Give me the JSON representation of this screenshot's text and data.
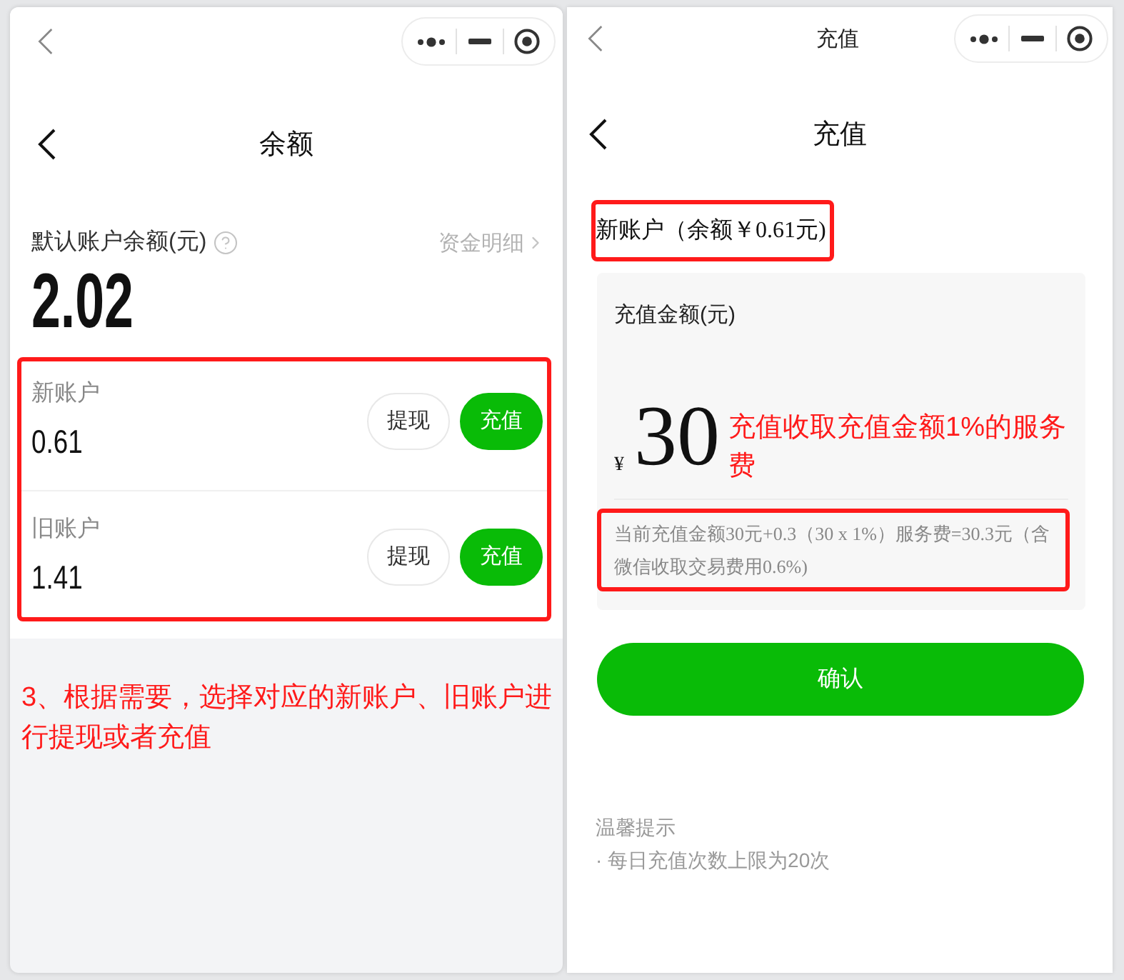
{
  "balance_screen": {
    "title": "余额",
    "balance": {
      "label": "默认账户余额(元)",
      "details_link": "资金明细",
      "amount": "2.02"
    },
    "accounts_box": {
      "highlighted": true,
      "accounts": [
        {
          "name": "新账户",
          "amount": "0.61",
          "actions": [
            {
              "label": "提现",
              "kind": "secondary"
            },
            {
              "label": "充值",
              "kind": "primary"
            }
          ]
        },
        {
          "name": "旧账户",
          "amount": "1.41",
          "actions": [
            {
              "label": "提现",
              "kind": "secondary"
            },
            {
              "label": "充值",
              "kind": "primary"
            }
          ]
        }
      ]
    },
    "annotation": "3、根据需要，选择对应的新账户、旧账户进行提现或者充值"
  },
  "recharge_screen": {
    "window_title": "充值",
    "title": "充值",
    "account": {
      "text": "新账户（余额￥0.61元)",
      "highlighted": true
    },
    "amount_card": {
      "label": "充值金额(元)",
      "currency": "¥",
      "amount": "30",
      "annotation": "充值收取充值金额1%的服务费",
      "fee_note": {
        "text": "当前充值金额30元+0.3（30 x 1%）服务费=30.3元（含微信收取交易费用0.6%)",
        "highlighted": true
      }
    },
    "confirm_button": "确认",
    "tips": {
      "title": "温馨提示",
      "items": [
        "· 每日充值次数上限为20次"
      ]
    }
  }
}
